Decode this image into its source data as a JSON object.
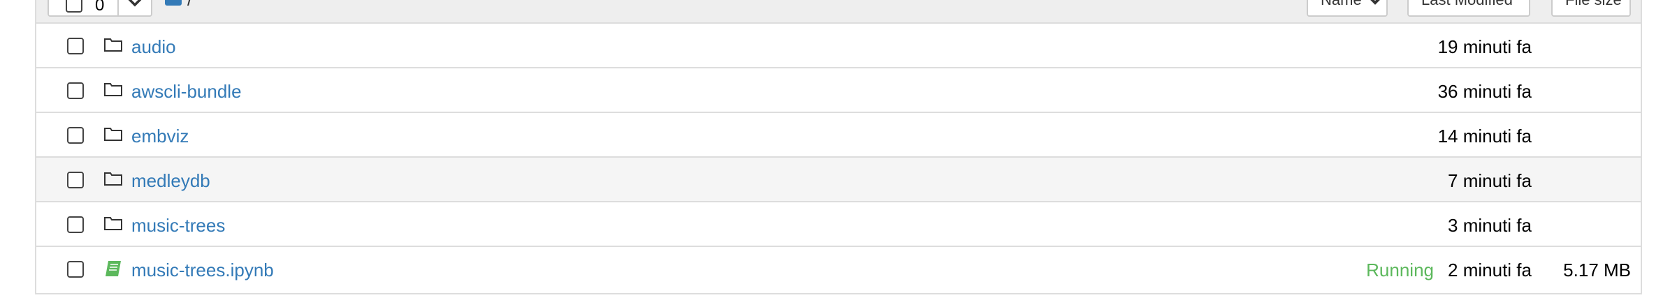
{
  "toolbar": {
    "selected_count": "0",
    "breadcrumb_separator": "/",
    "sort_name_label": "Name",
    "sort_modified_label": "Last Modified",
    "sort_size_label": "File size"
  },
  "colors": {
    "link": "#337ab7",
    "running": "#5cb85c",
    "header_bg": "#eeeeee",
    "row_hover": "#f5f5f5"
  },
  "items": [
    {
      "name": "audio",
      "icon": "folder-icon",
      "modified": "19 minuti fa",
      "status": "",
      "size": ""
    },
    {
      "name": "awscli-bundle",
      "icon": "folder-icon",
      "modified": "36 minuti fa",
      "status": "",
      "size": ""
    },
    {
      "name": "embviz",
      "icon": "folder-icon",
      "modified": "14 minuti fa",
      "status": "",
      "size": ""
    },
    {
      "name": "medleydb",
      "icon": "folder-icon",
      "modified": "7 minuti fa",
      "status": "",
      "size": ""
    },
    {
      "name": "music-trees",
      "icon": "folder-icon",
      "modified": "3 minuti fa",
      "status": "",
      "size": ""
    },
    {
      "name": "music-trees.ipynb",
      "icon": "notebook-icon",
      "modified": "2 minuti fa",
      "status": "Running",
      "size": "5.17 MB"
    }
  ]
}
